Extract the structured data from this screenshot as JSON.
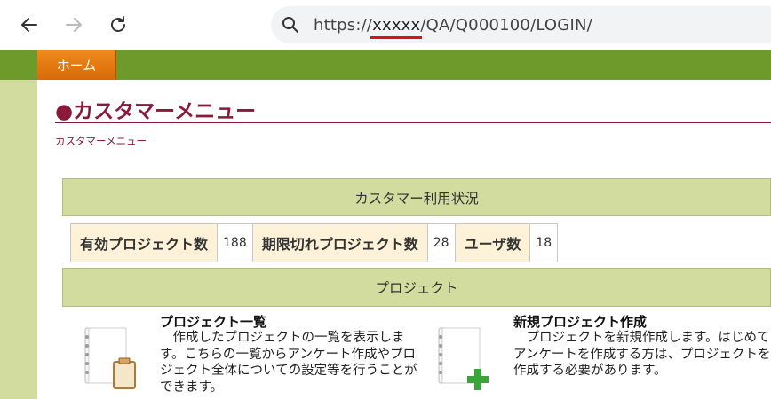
{
  "browser": {
    "url_prefix": "https://",
    "url_masked": "xxxxx",
    "url_suffix": "/QA/Q000100/LOGIN/"
  },
  "nav": {
    "home_label": "ホーム"
  },
  "page": {
    "title": "●カスタマーメニュー",
    "breadcrumb": "カスタマーメニュー"
  },
  "usage": {
    "heading": "カスタマー利用状況",
    "stats": [
      {
        "label": "有効プロジェクト数",
        "value": "188"
      },
      {
        "label": "期限切れプロジェクト数",
        "value": "28"
      },
      {
        "label": "ユーザ数",
        "value": "18"
      }
    ]
  },
  "project": {
    "heading": "プロジェクト",
    "cards": [
      {
        "title": "プロジェクト一覧",
        "description": "　作成したプロジェクトの一覧を表示します。こちらの一覧からアンケート作成やプロジェクト全体についての設定等を行うことができます。",
        "icon": "notebook-clipboard-icon"
      },
      {
        "title": "新規プロジェクト作成",
        "description": "　プロジェクトを新規作成します。はじめてアンケートを作成する方は、プロジェクトを作成する必要があります。",
        "icon": "notebook-add-icon"
      }
    ]
  },
  "colors": {
    "nav_green": "#6e9a2c",
    "strip_green": "#d3dc9f",
    "home_orange": "#e87a12",
    "title_maroon": "#8a1a3a",
    "stat_label_bg": "#fdf2d8",
    "mask_underline": "#e0101a"
  }
}
